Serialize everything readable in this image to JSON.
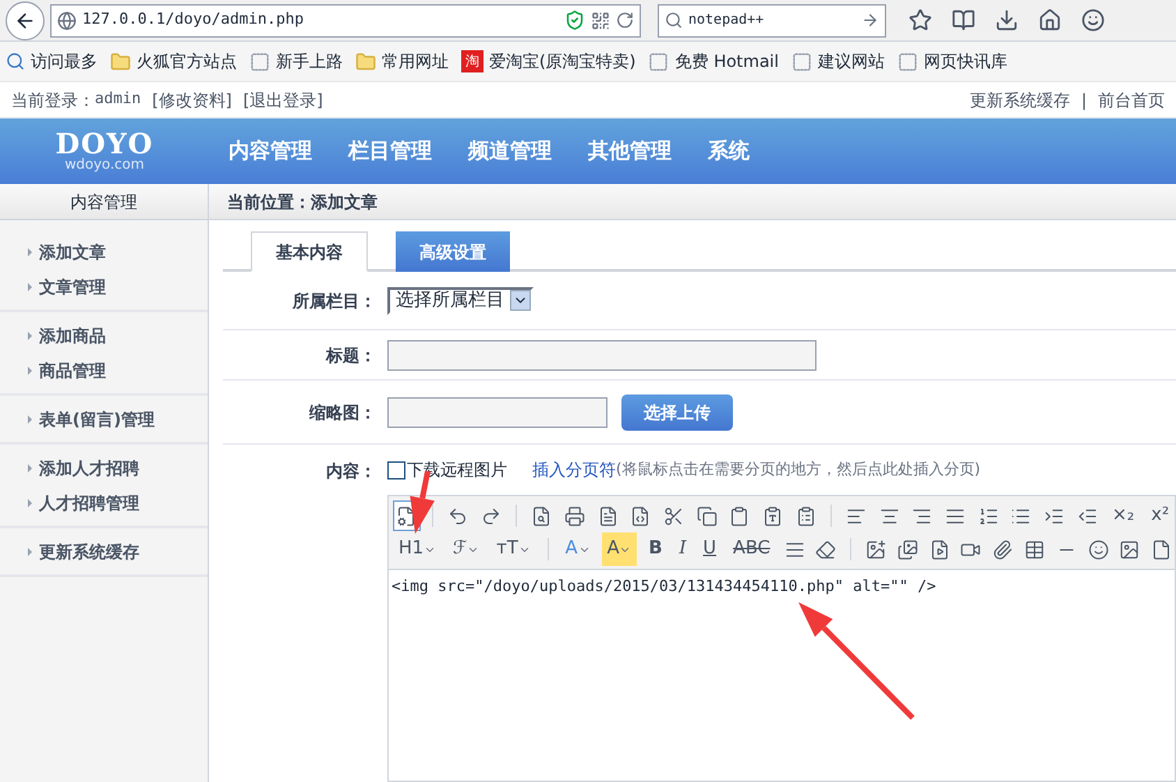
{
  "browser": {
    "url": "127.0.0.1/doyo/admin.php",
    "search": "notepad++"
  },
  "bookmarks": [
    {
      "label": "访问最多",
      "kind": "smart"
    },
    {
      "label": "火狐官方站点",
      "kind": "folder"
    },
    {
      "label": "新手上路",
      "kind": "page"
    },
    {
      "label": "常用网址",
      "kind": "folder"
    },
    {
      "label": "爱淘宝(原淘宝特卖)",
      "kind": "taobao",
      "badge": "淘"
    },
    {
      "label": "免费 Hotmail",
      "kind": "page"
    },
    {
      "label": "建议网站",
      "kind": "page"
    },
    {
      "label": "网页快讯库",
      "kind": "page"
    }
  ],
  "topbar": {
    "login_label": "当前登录：",
    "user": "admin",
    "links": [
      "[修改资料]",
      "[退出登录]"
    ],
    "right_links": [
      "更新系统缓存",
      "前台首页"
    ],
    "separator": "|"
  },
  "header": {
    "logo": "DOYO",
    "logo_sub": "wdoyo.com",
    "nav": [
      "内容管理",
      "栏目管理",
      "频道管理",
      "其他管理",
      "系统"
    ]
  },
  "sidebar": {
    "title": "内容管理",
    "groups": [
      [
        "添加文章",
        "文章管理"
      ],
      [
        "添加商品",
        "商品管理"
      ],
      [
        "表单(留言)管理"
      ],
      [
        "添加人才招聘",
        "人才招聘管理"
      ],
      [
        "更新系统缓存"
      ]
    ]
  },
  "breadcrumb": "当前位置：添加文章",
  "tabs": [
    {
      "label": "基本内容",
      "selected": true
    },
    {
      "label": "高级设置",
      "selected": false
    }
  ],
  "form": {
    "category_label": "所属栏目：",
    "category_value": "选择所属栏目",
    "title_label": "标题：",
    "thumb_label": "缩略图：",
    "upload_button": "选择上传",
    "content_label": "内容：",
    "download_remote": {
      "label": "下载远程图片",
      "checked": false
    },
    "page_break_link": "插入分页符",
    "page_break_hint": "(将鼠标点击在需要分页的地方，然后点此处插入分页)"
  },
  "editor": {
    "toolbar": [
      [
        {
          "kind": "source",
          "selected": true
        },
        {
          "kind": "sep"
        },
        {
          "kind": "undo"
        },
        {
          "kind": "redo"
        },
        {
          "kind": "sep"
        },
        {
          "kind": "preview"
        },
        {
          "kind": "print"
        },
        {
          "kind": "template"
        },
        {
          "kind": "code"
        },
        {
          "kind": "cut"
        },
        {
          "kind": "copy"
        },
        {
          "kind": "paste"
        },
        {
          "kind": "pastetext"
        },
        {
          "kind": "pasteword"
        },
        {
          "kind": "sep"
        },
        {
          "kind": "alignleft"
        },
        {
          "kind": "aligncenter"
        },
        {
          "kind": "alignright"
        },
        {
          "kind": "justify"
        },
        {
          "kind": "ordered"
        },
        {
          "kind": "bullets"
        },
        {
          "kind": "indent"
        },
        {
          "kind": "outdent"
        },
        {
          "kind": "text",
          "label": "×₂"
        },
        {
          "kind": "text",
          "label": "x²"
        }
      ],
      [
        {
          "kind": "drop",
          "label": "H1"
        },
        {
          "kind": "drop",
          "label": "ℱ"
        },
        {
          "kind": "drop",
          "label": "тT"
        },
        {
          "kind": "sep"
        },
        {
          "kind": "drop",
          "label": "A",
          "color": "#4a8de0"
        },
        {
          "kind": "highlight",
          "label": "A",
          "color": "#ffe070"
        },
        {
          "kind": "bold",
          "label": "B"
        },
        {
          "kind": "italic",
          "label": "I"
        },
        {
          "kind": "underline",
          "label": "U"
        },
        {
          "kind": "strike",
          "label": "ABC"
        },
        {
          "kind": "hr"
        },
        {
          "kind": "eraser"
        },
        {
          "kind": "sep"
        },
        {
          "kind": "image"
        },
        {
          "kind": "images"
        },
        {
          "kind": "flash"
        },
        {
          "kind": "video"
        },
        {
          "kind": "attach"
        },
        {
          "kind": "table"
        },
        {
          "kind": "line"
        },
        {
          "kind": "smile"
        },
        {
          "kind": "picture"
        },
        {
          "kind": "page"
        }
      ]
    ],
    "content": "<img src=\"/doyo/uploads/2015/03/131434454110.php\" alt=\"\" />"
  }
}
